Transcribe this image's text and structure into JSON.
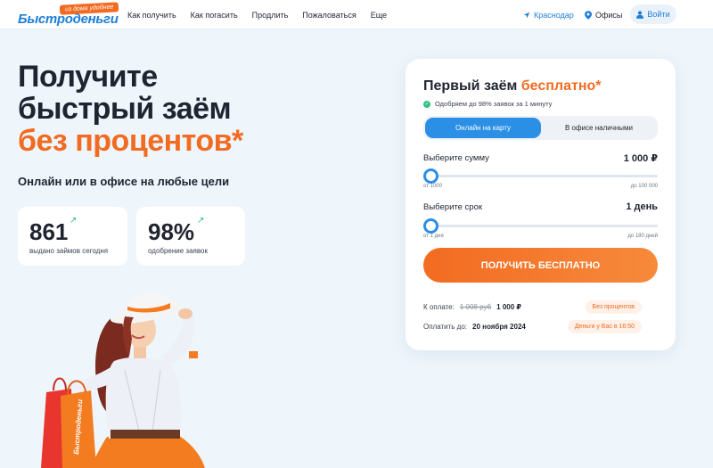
{
  "header": {
    "logo_tag": "из дома удобнее",
    "logo_text": "Быстроденьги",
    "nav": [
      "Как получить",
      "Как погасить",
      "Продлить",
      "Пожаловаться",
      "Еще"
    ],
    "city": "Краснодар",
    "offices": "Офисы",
    "login": "Войти"
  },
  "hero": {
    "title_line1": "Получите",
    "title_line2": "быстрый заём",
    "title_accent": "без процентов*",
    "subtitle": "Онлайн или в офисе на любые цели",
    "stats": [
      {
        "value": "861",
        "label": "выдано займов сегодня"
      },
      {
        "value": "98%",
        "label": "одобрение заявок"
      }
    ],
    "bag_text": "Быстроденьги"
  },
  "card": {
    "title": "Первый заём",
    "title_accent": "бесплатно*",
    "approve_text": "Одобряем до 98% заявок за 1 минуту",
    "tabs": [
      "Онлайн на карту",
      "В офисе наличными"
    ],
    "amount": {
      "label": "Выберите сумму",
      "value": "1 000 ₽",
      "min": "от 1000",
      "max": "до 100 000",
      "level": 0
    },
    "term": {
      "label": "Выберите срок",
      "value": "1 день",
      "min": "от 1 дня",
      "max": "до 180 дней",
      "level": 0
    },
    "cta": "ПОЛУЧИТЬ БЕСПЛАТНО",
    "pay_label": "К оплате:",
    "old_price": "1 008 руб",
    "new_price": "1 000 ₽",
    "pay_badge": "Без процентов",
    "date_label": "Оплатить до:",
    "date_value": "20 ноября 2024",
    "date_badge": "Деньги у Вас в 16:50"
  },
  "colors": {
    "accent": "#f26b21",
    "brand": "#2b8fe6",
    "success": "#2ec27e"
  }
}
